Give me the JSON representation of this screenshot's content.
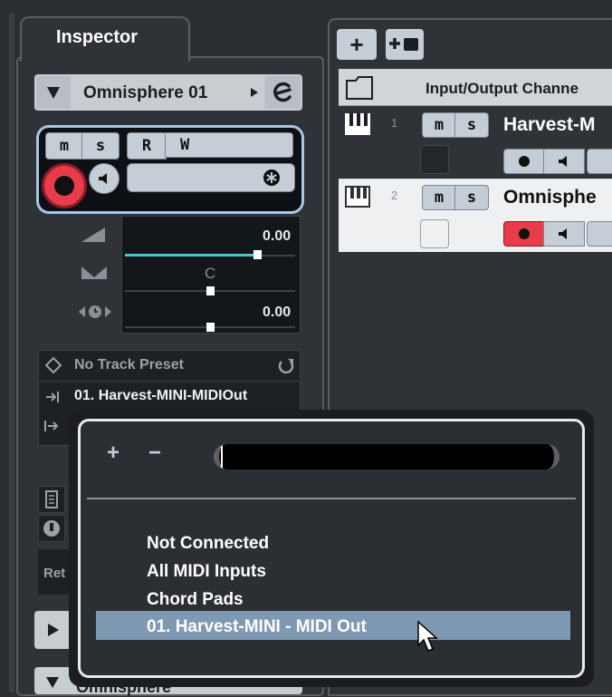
{
  "inspector": {
    "tab_label": "Inspector",
    "track_name": "Omnisphere 01",
    "mute_label": "m",
    "solo_label": "s",
    "read_label": "R",
    "write_label": "W",
    "volume_value": "0.00",
    "pan_value": "C",
    "delay_value": "0.00",
    "preset_label": "No Track Preset",
    "input_routing": "01. Harvest-MINI-MIDIOut",
    "partial_label": "Ret",
    "bottom_track_name": "Omnisphere"
  },
  "toolbar": {
    "add_label": "+"
  },
  "tracklist": {
    "header": "Input/Output Channe",
    "tracks": [
      {
        "number": "1",
        "name": "Harvest-M",
        "mute": "m",
        "solo": "s"
      },
      {
        "number": "2",
        "name": "Omnisphe",
        "mute": "m",
        "solo": "s"
      }
    ]
  },
  "popup": {
    "plus_label": "+",
    "minus_label": "−",
    "search_value": "",
    "items": [
      "Not Connected",
      "All MIDI Inputs",
      "Chord Pads",
      "01. Harvest-MINI - MIDI Out"
    ],
    "selected_index": 3
  },
  "colors": {
    "record_red": "#e83c4b",
    "accent_blue": "#a9c6e6",
    "fader_cyan": "#4cc3d4",
    "selection_blue": "#7f99b3"
  },
  "icons": [
    "triangle-down-icon",
    "edit-icon",
    "record-icon",
    "speaker-icon",
    "asterisk-icon",
    "volume-icon",
    "pan-icon",
    "delay-icon",
    "preset-icon",
    "refresh-icon",
    "input-icon",
    "output-icon",
    "folder-icon",
    "piano-icon",
    "cursor-icon"
  ]
}
